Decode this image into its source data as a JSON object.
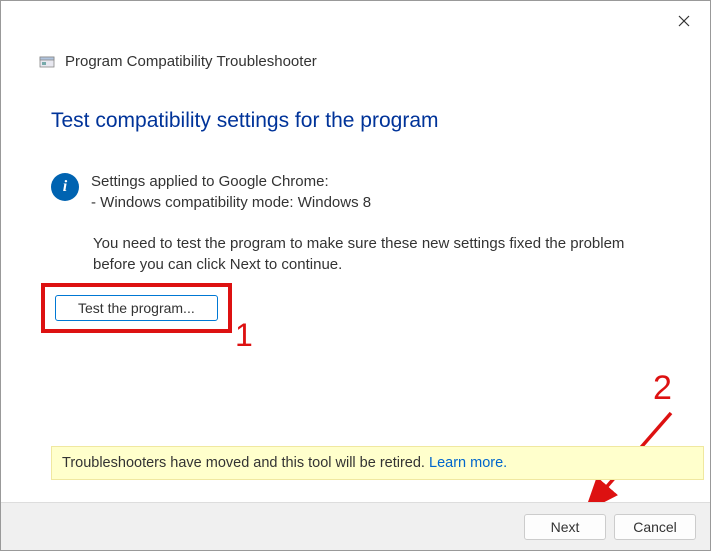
{
  "header": {
    "title": "Program Compatibility Troubleshooter"
  },
  "main": {
    "heading": "Test compatibility settings for the program",
    "info_line1": "Settings applied to Google Chrome:",
    "info_line2": "- Windows compatibility mode: Windows 8",
    "instruction": "You need to test the program to make sure these new settings fixed the problem before you can click Next to continue.",
    "test_button": "Test the program..."
  },
  "notice": {
    "text": "Troubleshooters have moved and this tool will be retired. ",
    "link": "Learn more."
  },
  "footer": {
    "next": "Next",
    "cancel": "Cancel"
  },
  "annotations": {
    "one": "1",
    "two": "2"
  }
}
